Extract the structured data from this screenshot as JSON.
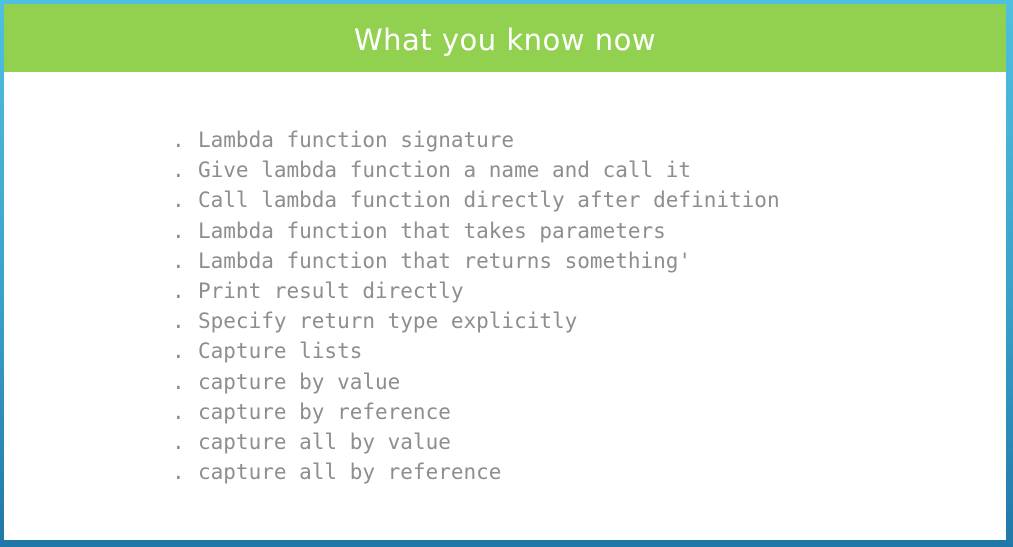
{
  "slide": {
    "title": "What you know now",
    "bullet_symbol": ".",
    "items": [
      "Lambda function signature",
      "Give lambda function a name and call it",
      "Call lambda function directly after definition",
      "Lambda function that takes parameters",
      "Lambda function that returns something'",
      "Print result directly",
      "Specify return type explicitly",
      "Capture lists",
      "capture by value",
      "capture by reference",
      "capture all by value",
      "capture all by reference"
    ]
  },
  "colors": {
    "header": "#92d050",
    "title_text": "#ffffff",
    "body_text": "#8e8e8e",
    "frame": "#3aa0c8"
  }
}
